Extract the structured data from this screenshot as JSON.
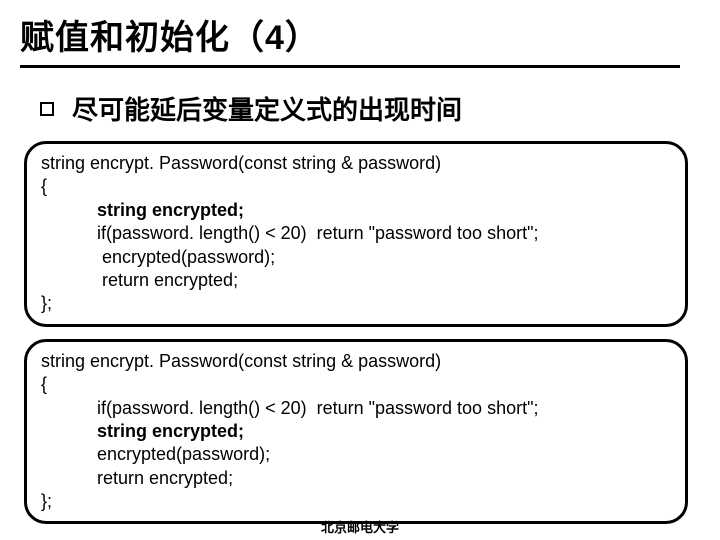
{
  "title": "赋值和初始化（4）",
  "bullet": "尽可能延后变量定义式的出现时间",
  "code1": {
    "l1": "string encrypt. Password(const string & password)",
    "l2": "{",
    "l3": "string encrypted;",
    "l4": "if(password. length() < 20)  return \"password too short\";",
    "l5": " encrypted(password);",
    "l6": " return encrypted;",
    "l7": "};"
  },
  "code2": {
    "l1": "string encrypt. Password(const string & password)",
    "l2": "{",
    "l3": "if(password. length() < 20)  return \"password too short\";",
    "l4": "string encrypted;",
    "l5": "encrypted(password);",
    "l6": "return encrypted;",
    "l7": "};"
  },
  "footer": "北京邮电大学"
}
